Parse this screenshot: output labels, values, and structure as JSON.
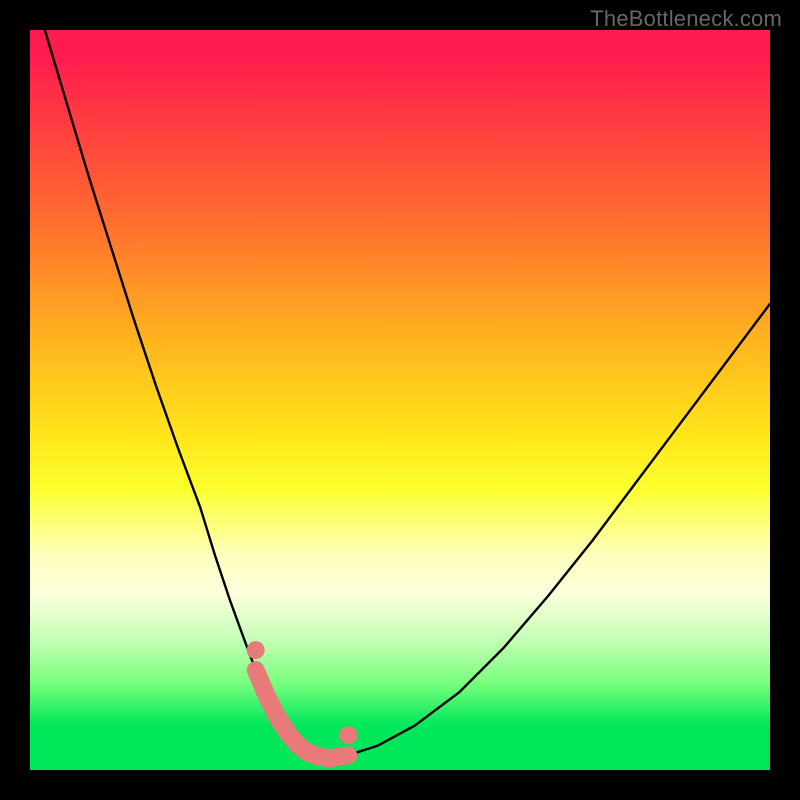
{
  "watermark": "TheBottleneck.com",
  "colors": {
    "frame": "#000000",
    "gradient_top": "#ff1a4f",
    "gradient_mid": "#ffe61a",
    "gradient_bottom": "#00e85a",
    "curve": "#000000",
    "marker_stroke": "#e97a7a",
    "marker_fill": "#e97a7a"
  },
  "chart_data": {
    "type": "line",
    "title": "",
    "xlabel": "",
    "ylabel": "",
    "xlim": [
      0,
      100
    ],
    "ylim": [
      0,
      100
    ],
    "series": [
      {
        "name": "bottleneck-curve",
        "x": [
          2,
          5,
          8,
          11,
          14,
          17,
          20,
          23,
          25,
          27,
          29,
          30.5,
          32,
          33.5,
          35,
          36.3,
          37.5,
          39,
          40.5,
          43,
          47,
          52,
          58,
          64,
          70,
          76,
          82,
          88,
          94,
          100
        ],
        "y": [
          100,
          90,
          80,
          70.5,
          61,
          52,
          43.5,
          35.5,
          29,
          23,
          17.5,
          13.5,
          10,
          7,
          4.8,
          3.3,
          2.4,
          1.8,
          1.6,
          2.0,
          3.3,
          6.0,
          10.5,
          16.5,
          23.5,
          31.0,
          39.0,
          47.0,
          55.0,
          63.0
        ]
      }
    ],
    "markers": {
      "name": "highlight-segment",
      "x": [
        30.5,
        32,
        33.5,
        35,
        36.3,
        37.5,
        39,
        40.5,
        43
      ],
      "y": [
        13.5,
        10,
        7,
        4.8,
        3.3,
        2.4,
        1.8,
        1.6,
        2.0
      ]
    }
  }
}
